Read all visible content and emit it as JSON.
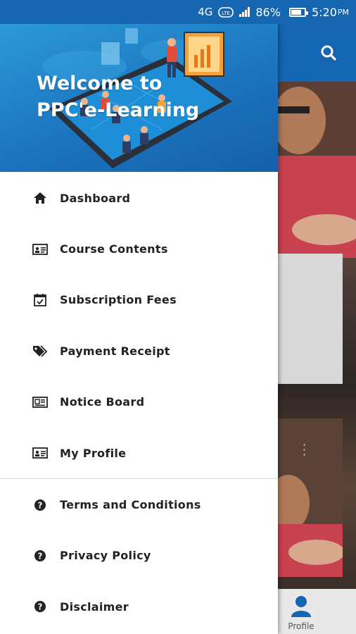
{
  "status_bar": {
    "network": "4G",
    "volte": "VoLTE",
    "battery": "86%",
    "time": "5:20",
    "ampm": "PM"
  },
  "drawer": {
    "welcome_line1": "Welcome to",
    "welcome_line2": "PPC'e-Learning",
    "menu_primary": [
      {
        "label": "Dashboard",
        "icon": "home-icon"
      },
      {
        "label": "Course Contents",
        "icon": "id-card-icon"
      },
      {
        "label": "Subscription Fees",
        "icon": "calendar-check-icon"
      },
      {
        "label": "Payment Receipt",
        "icon": "tags-icon"
      },
      {
        "label": "Notice Board",
        "icon": "newspaper-icon"
      },
      {
        "label": "My Profile",
        "icon": "id-card-icon"
      }
    ],
    "menu_secondary": [
      {
        "label": "Terms and Conditions",
        "icon": "question-circle-icon"
      },
      {
        "label": "Privacy Policy",
        "icon": "question-circle-icon"
      },
      {
        "label": "Disclaimer",
        "icon": "question-circle-icon"
      }
    ]
  },
  "background": {
    "bottom_nav_profile": "Profile"
  },
  "colors": {
    "primary": "#1466b2",
    "header_gradient_start": "#2b9ad8",
    "menu_text": "#222222"
  }
}
